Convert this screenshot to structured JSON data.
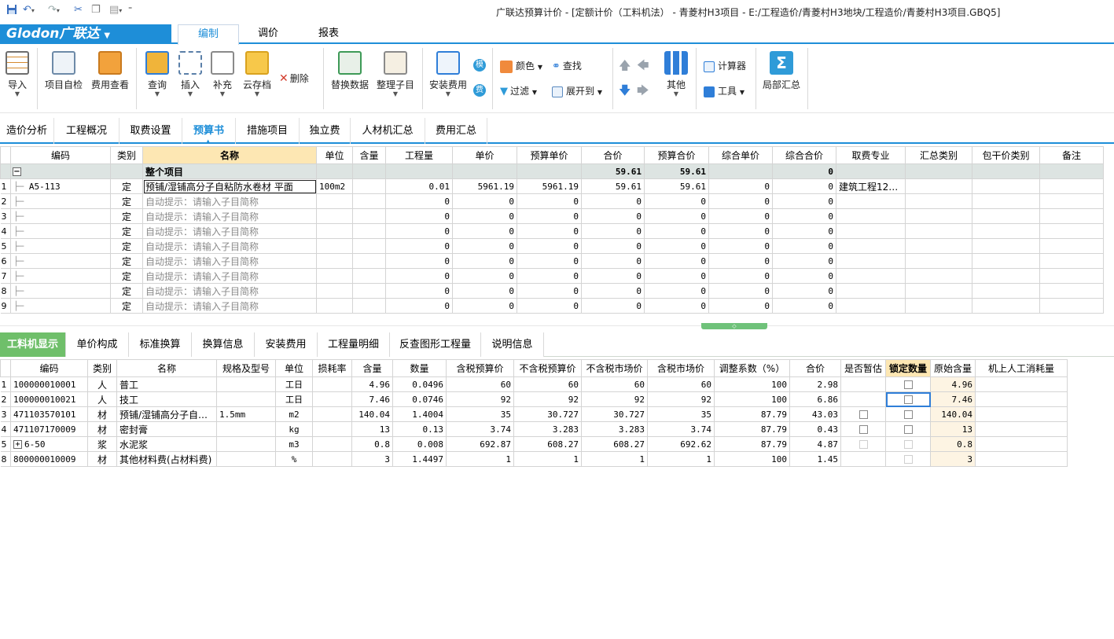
{
  "window": {
    "title": "广联达预算计价 - [定额计价（工料机法） - 青菱村H3项目 - E:/工程造价/青菱村H3地块/工程造价/青菱村H3项目.GBQ5]"
  },
  "quick_access": [
    "save-icon",
    "undo-icon",
    "redo-icon",
    "cut-icon",
    "copy-icon",
    "paste-icon",
    "more-icon"
  ],
  "menubar": {
    "logo": "Glodon广联达",
    "tabs": [
      "编制",
      "调价",
      "报表"
    ],
    "active_tab": "编制"
  },
  "ribbon": {
    "import": "导入",
    "self_check": "项目自检",
    "fee_view": "费用查看",
    "query": "查询",
    "insert": "插入",
    "supplement": "补充",
    "cloud_archive": "云存档",
    "delete": "删除",
    "replace_data": "替换数据",
    "organize_sub": "整理子目",
    "install_fee": "安装费用",
    "mo": "模",
    "fei": "费",
    "color": "颜色",
    "find": "查找",
    "filter": "过滤",
    "expand_to": "展开到",
    "other": "其他",
    "calculator": "计算器",
    "tools": "工具",
    "local_summary": "局部汇总"
  },
  "main_tabs": [
    "造价分析",
    "工程概况",
    "取费设置",
    "预算书",
    "措施项目",
    "独立费",
    "人材机汇总",
    "费用汇总"
  ],
  "main_active_tab": "预算书",
  "budget": {
    "headers": [
      "编码",
      "类别",
      "名称",
      "单位",
      "含量",
      "工程量",
      "单价",
      "预算单价",
      "合价",
      "预算合价",
      "综合单价",
      "综合合价",
      "取费专业",
      "汇总类别",
      "包干价类别",
      "备注"
    ],
    "summary": {
      "name": "整个项目",
      "total": "59.61",
      "budget_total": "59.61",
      "comp_total": "0"
    },
    "rows": [
      {
        "no": "1",
        "code": "A5-113",
        "type": "定",
        "name": "预铺/湿铺高分子自粘防水卷材 平面",
        "unit": "100m2",
        "content": "",
        "qty": "0.01",
        "price": "5961.19",
        "budget_price": "5961.19",
        "total": "59.61",
        "budget_total": "59.61",
        "comp_price": "0",
        "comp_total": "0",
        "fee_major": "建筑工程12…"
      },
      {
        "no": "2",
        "code": "",
        "type": "定",
        "name": "自动提示：请输入子目简称",
        "unit": "",
        "content": "",
        "qty": "0",
        "price": "0",
        "budget_price": "0",
        "total": "0",
        "budget_total": "0",
        "comp_price": "0",
        "comp_total": "0",
        "fee_major": ""
      },
      {
        "no": "3",
        "code": "",
        "type": "定",
        "name": "自动提示：请输入子目简称",
        "unit": "",
        "content": "",
        "qty": "0",
        "price": "0",
        "budget_price": "0",
        "total": "0",
        "budget_total": "0",
        "comp_price": "0",
        "comp_total": "0",
        "fee_major": ""
      },
      {
        "no": "4",
        "code": "",
        "type": "定",
        "name": "自动提示：请输入子目简称",
        "unit": "",
        "content": "",
        "qty": "0",
        "price": "0",
        "budget_price": "0",
        "total": "0",
        "budget_total": "0",
        "comp_price": "0",
        "comp_total": "0",
        "fee_major": ""
      },
      {
        "no": "5",
        "code": "",
        "type": "定",
        "name": "自动提示：请输入子目简称",
        "unit": "",
        "content": "",
        "qty": "0",
        "price": "0",
        "budget_price": "0",
        "total": "0",
        "budget_total": "0",
        "comp_price": "0",
        "comp_total": "0",
        "fee_major": ""
      },
      {
        "no": "6",
        "code": "",
        "type": "定",
        "name": "自动提示：请输入子目简称",
        "unit": "",
        "content": "",
        "qty": "0",
        "price": "0",
        "budget_price": "0",
        "total": "0",
        "budget_total": "0",
        "comp_price": "0",
        "comp_total": "0",
        "fee_major": ""
      },
      {
        "no": "7",
        "code": "",
        "type": "定",
        "name": "自动提示：请输入子目简称",
        "unit": "",
        "content": "",
        "qty": "0",
        "price": "0",
        "budget_price": "0",
        "total": "0",
        "budget_total": "0",
        "comp_price": "0",
        "comp_total": "0",
        "fee_major": ""
      },
      {
        "no": "8",
        "code": "",
        "type": "定",
        "name": "自动提示：请输入子目简称",
        "unit": "",
        "content": "",
        "qty": "0",
        "price": "0",
        "budget_price": "0",
        "total": "0",
        "budget_total": "0",
        "comp_price": "0",
        "comp_total": "0",
        "fee_major": ""
      },
      {
        "no": "9",
        "code": "",
        "type": "定",
        "name": "自动提示：请输入子目简称",
        "unit": "",
        "content": "",
        "qty": "0",
        "price": "0",
        "budget_price": "0",
        "total": "0",
        "budget_total": "0",
        "comp_price": "0",
        "comp_total": "0",
        "fee_major": ""
      }
    ]
  },
  "bottom_tabs": [
    "工料机显示",
    "单价构成",
    "标准换算",
    "换算信息",
    "安装费用",
    "工程量明细",
    "反查图形工程量",
    "说明信息"
  ],
  "bottom_active_tab": "工料机显示",
  "materials": {
    "headers": [
      "编码",
      "类别",
      "名称",
      "规格及型号",
      "单位",
      "损耗率",
      "含量",
      "数量",
      "含税预算价",
      "不含税预算价",
      "不含税市场价",
      "含税市场价",
      "调整系数（%）",
      "合价",
      "是否暂估",
      "锁定数量",
      "原始含量",
      "机上人工消耗量"
    ],
    "rows": [
      {
        "no": "1",
        "code": "100000010001",
        "type": "人",
        "name": "普工",
        "spec": "",
        "unit": "工日",
        "loss": "",
        "content": "4.96",
        "qty": "0.0496",
        "tax_budget": "60",
        "notax_budget": "60",
        "notax_market": "60",
        "tax_market": "60",
        "coef": "100",
        "total": "2.98",
        "provisional": "",
        "locked": "",
        "orig": "4.96",
        "machine": ""
      },
      {
        "no": "2",
        "code": "100000010021",
        "type": "人",
        "name": "技工",
        "spec": "",
        "unit": "工日",
        "loss": "",
        "content": "7.46",
        "qty": "0.0746",
        "tax_budget": "92",
        "notax_budget": "92",
        "notax_market": "92",
        "tax_market": "92",
        "coef": "100",
        "total": "6.86",
        "provisional": "",
        "locked": "",
        "orig": "7.46",
        "machine": ""
      },
      {
        "no": "3",
        "code": "471103570101",
        "type": "材",
        "name": "预铺/湿铺高分子自…",
        "spec": "1.5mm",
        "unit": "m2",
        "loss": "",
        "content": "140.04",
        "qty": "1.4004",
        "tax_budget": "35",
        "notax_budget": "30.727",
        "notax_market": "30.727",
        "tax_market": "35",
        "coef": "87.79",
        "total": "43.03",
        "provisional": "",
        "locked": "",
        "orig": "140.04",
        "machine": ""
      },
      {
        "no": "4",
        "code": "471107170009",
        "type": "材",
        "name": "密封膏",
        "spec": "",
        "unit": "kg",
        "loss": "",
        "content": "13",
        "qty": "0.13",
        "tax_budget": "3.74",
        "notax_budget": "3.283",
        "notax_market": "3.283",
        "tax_market": "3.74",
        "coef": "87.79",
        "total": "0.43",
        "provisional": "",
        "locked": "",
        "orig": "13",
        "machine": ""
      },
      {
        "no": "5",
        "code": "6-50",
        "type": "浆",
        "name": "水泥浆",
        "spec": "",
        "unit": "m3",
        "loss": "",
        "content": "0.8",
        "qty": "0.008",
        "tax_budget": "692.87",
        "notax_budget": "608.27",
        "notax_market": "608.27",
        "tax_market": "692.62",
        "coef": "87.79",
        "total": "4.87",
        "provisional": "",
        "locked": "",
        "orig": "0.8",
        "machine": ""
      },
      {
        "no": "8",
        "code": "800000010009",
        "type": "材",
        "name": "其他材料费(占材料费)",
        "spec": "",
        "unit": "%",
        "loss": "",
        "content": "3",
        "qty": "1.4497",
        "tax_budget": "1",
        "notax_budget": "1",
        "notax_market": "1",
        "tax_market": "1",
        "coef": "100",
        "total": "1.45",
        "provisional": "",
        "locked": "",
        "orig": "3",
        "machine": ""
      }
    ]
  },
  "colors": {
    "brand_blue": "#1e8ed8",
    "active_green_tab": "#6fbf6a",
    "header_highlight": "#fde7b3",
    "summary_row": "#dde4e2"
  }
}
